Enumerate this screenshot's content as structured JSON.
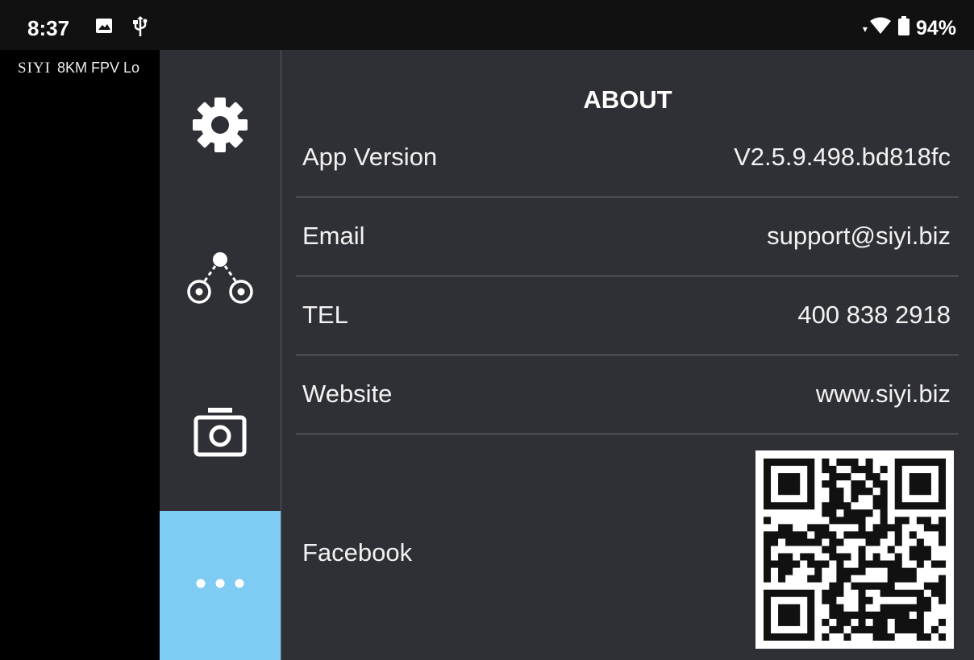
{
  "status_bar": {
    "time": "8:37",
    "battery": "94%"
  },
  "video": {
    "brand": "SIYI",
    "title": "8KM FPV Lo"
  },
  "nav": {
    "items": [
      {
        "icon": "gear-icon"
      },
      {
        "icon": "network-link-icon"
      },
      {
        "icon": "camera-icon"
      },
      {
        "icon": "more-icon",
        "active": true
      }
    ]
  },
  "about": {
    "title": "ABOUT",
    "rows": [
      {
        "label": "App Version",
        "value": "V2.5.9.498.bd818fc"
      },
      {
        "label": "Email",
        "value": "support@siyi.biz"
      },
      {
        "label": "TEL",
        "value": "400 838 2918"
      },
      {
        "label": "Website",
        "value": "www.siyi.biz"
      }
    ],
    "facebook_label": "Facebook"
  },
  "colors": {
    "accent": "#7ecbf4",
    "panel": "#2f3035"
  }
}
